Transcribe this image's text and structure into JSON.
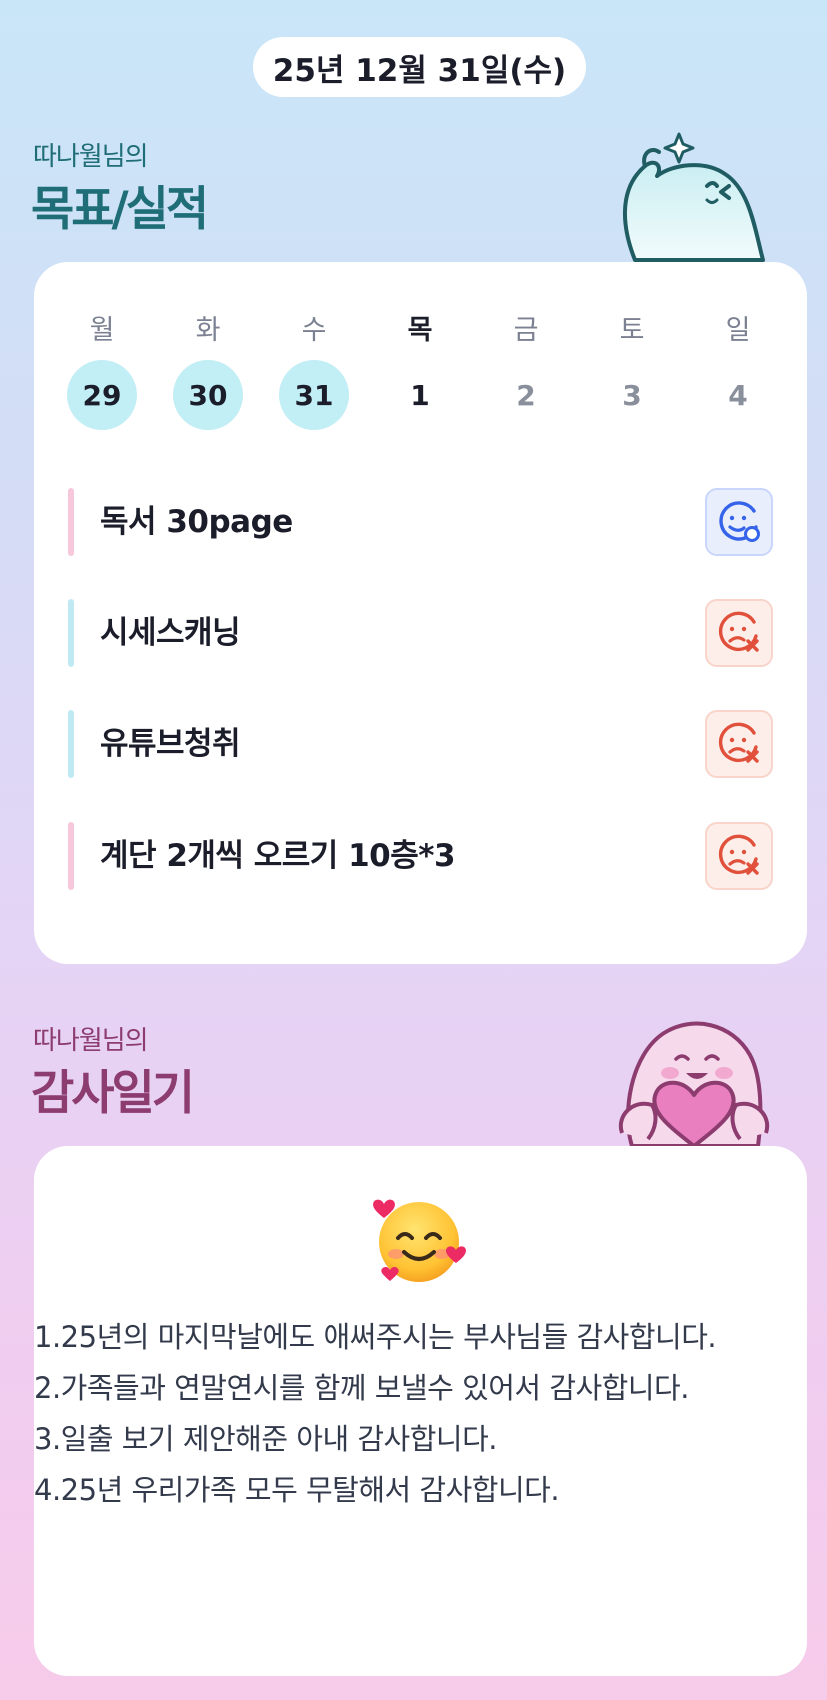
{
  "date_label": "25년 12월 31일(수)",
  "goals_section": {
    "subtitle": "따나월님의",
    "title": "목표/실적"
  },
  "week": {
    "days": [
      {
        "day": "월",
        "date": "29",
        "status": "done"
      },
      {
        "day": "화",
        "date": "30",
        "status": "done"
      },
      {
        "day": "수",
        "date": "31",
        "status": "done"
      },
      {
        "day": "목",
        "date": "1",
        "status": "today"
      },
      {
        "day": "금",
        "date": "2",
        "status": "future"
      },
      {
        "day": "토",
        "date": "3",
        "status": "future"
      },
      {
        "day": "일",
        "date": "4",
        "status": "future"
      }
    ]
  },
  "goals": [
    {
      "text": "독서 30page",
      "accent": "#f7c8dc",
      "result": "achieved",
      "icon": "smile-check-icon"
    },
    {
      "text": "시세스캐닝",
      "accent": "#bfeaf4",
      "result": "failed",
      "icon": "sad-x-icon"
    },
    {
      "text": "유튜브청취",
      "accent": "#bfeaf4",
      "result": "failed",
      "icon": "sad-x-icon"
    },
    {
      "text": "계단 2개씩 오르기 10층*3",
      "accent": "#f7c8dc",
      "result": "failed",
      "icon": "sad-x-icon"
    }
  ],
  "gratitude_section": {
    "subtitle": "따나월님의",
    "title": "감사일기",
    "emoji": "smiling-face-with-hearts-icon",
    "lines": [
      "1.25년의 마지막날에도 애써주시는 부사님들 감사합니다.",
      "2.가족들과 연말연시를 함께 보낼수 있어서 감사합니다.",
      "3.일출 보기 제안해준 아내 감사합니다.",
      "4.25년 우리가족 모두 무탈해서 감사합니다."
    ]
  },
  "colors": {
    "teal_title": "#1f6e77",
    "plum_title": "#8c3c6e",
    "done_circle": "#c2eef5",
    "ok_icon": "#3563e9",
    "fail_icon": "#e0503a"
  }
}
